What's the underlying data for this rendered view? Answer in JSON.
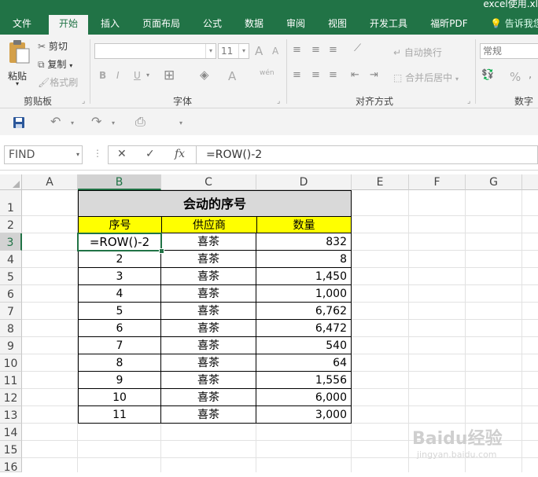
{
  "window": {
    "title_fragment": "excel使用.xl"
  },
  "ribbon": {
    "tabs": [
      "文件",
      "开始",
      "插入",
      "页面布局",
      "公式",
      "数据",
      "审阅",
      "视图",
      "开发工具",
      "福昕PDF"
    ],
    "active_tab": "开始",
    "tell_me": "告诉我您",
    "clipboard": {
      "paste": "粘贴",
      "cut": "剪切",
      "copy": "复制",
      "format_painter": "格式刷",
      "group_label": "剪贴板"
    },
    "font": {
      "font_size": "11",
      "group_label": "字体",
      "bold": "B",
      "italic": "I",
      "underline": "U",
      "grow": "A",
      "shrink": "A",
      "font_color": "A",
      "phonetic": "wén"
    },
    "alignment": {
      "wrap_text": "自动换行",
      "merge_center": "合并后居中",
      "group_label": "对齐方式"
    },
    "number": {
      "format": "常规",
      "percent": "%",
      "group_label": "数字"
    }
  },
  "formula_bar": {
    "name_box": "FIND",
    "cancel": "✕",
    "enter": "✓",
    "fx": "fx",
    "formula": "=ROW()-2"
  },
  "sheet": {
    "columns": [
      "A",
      "B",
      "C",
      "D",
      "E",
      "F",
      "G"
    ],
    "selected_column": "B",
    "rows": [
      "1",
      "2",
      "3",
      "4",
      "5",
      "6",
      "7",
      "8",
      "9",
      "10",
      "11",
      "12",
      "13",
      "14",
      "15",
      "16"
    ],
    "selected_row": "3",
    "table_title": "会动的序号",
    "headers": [
      "序号",
      "供应商",
      "数量"
    ],
    "editing_cell": "=ROW()-2",
    "data_rows": [
      {
        "seq": "",
        "supplier": "喜茶",
        "qty": "832"
      },
      {
        "seq": "2",
        "supplier": "喜茶",
        "qty": "8"
      },
      {
        "seq": "3",
        "supplier": "喜茶",
        "qty": "1,450"
      },
      {
        "seq": "4",
        "supplier": "喜茶",
        "qty": "1,000"
      },
      {
        "seq": "5",
        "supplier": "喜茶",
        "qty": "6,762"
      },
      {
        "seq": "6",
        "supplier": "喜茶",
        "qty": "6,472"
      },
      {
        "seq": "7",
        "supplier": "喜茶",
        "qty": "540"
      },
      {
        "seq": "8",
        "supplier": "喜茶",
        "qty": "64"
      },
      {
        "seq": "9",
        "supplier": "喜茶",
        "qty": "1,556"
      },
      {
        "seq": "10",
        "supplier": "喜茶",
        "qty": "6,000"
      },
      {
        "seq": "11",
        "supplier": "喜茶",
        "qty": "3,000"
      }
    ]
  },
  "watermark": {
    "brand": "Baidu经验",
    "url": "jingyan.baidu.com"
  },
  "colors": {
    "excel_green": "#217346",
    "header_yellow": "#ffff00",
    "title_gray": "#d9d9d9"
  }
}
